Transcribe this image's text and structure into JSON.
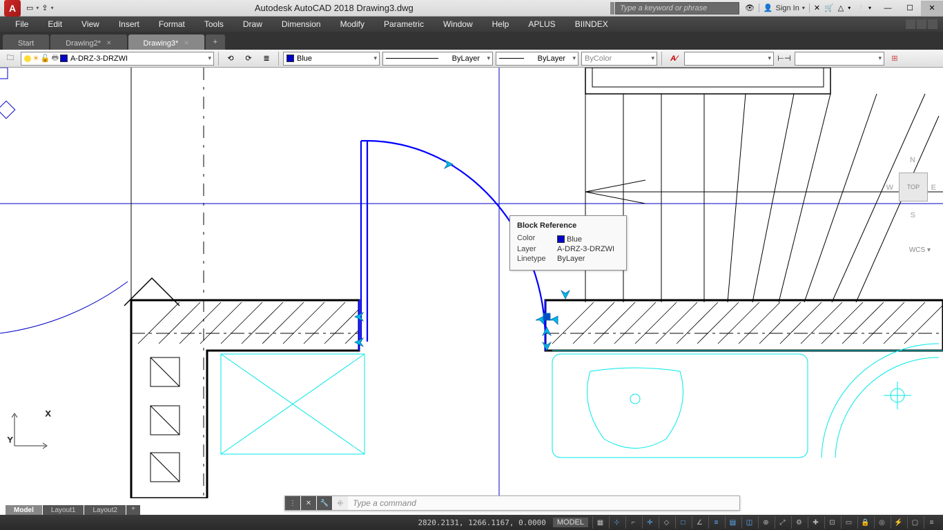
{
  "app": {
    "title": "Autodesk AutoCAD 2018   Drawing3.dwg",
    "search_placeholder": "Type a keyword or phrase",
    "signin": "Sign In"
  },
  "menus": [
    "File",
    "Edit",
    "View",
    "Insert",
    "Format",
    "Tools",
    "Draw",
    "Dimension",
    "Modify",
    "Parametric",
    "Window",
    "Help",
    "APLUS",
    "BIINDEX"
  ],
  "doc_tabs": [
    {
      "label": "Start",
      "active": false
    },
    {
      "label": "Drawing2*",
      "active": false
    },
    {
      "label": "Drawing3*",
      "active": true
    }
  ],
  "toolbar": {
    "layer": "A-DRZ-3-DRZWI",
    "color": "Blue",
    "linetype": "ByLayer",
    "lineweight": "ByLayer",
    "plotstyle": "ByColor"
  },
  "tooltip": {
    "title": "Block Reference",
    "rows": [
      {
        "label": "Color",
        "value": "Blue",
        "swatch": true
      },
      {
        "label": "Layer",
        "value": "A-DRZ-3-DRZWI"
      },
      {
        "label": "Linetype",
        "value": "ByLayer"
      }
    ]
  },
  "command_placeholder": "Type a command",
  "layout_tabs": [
    {
      "label": "Model",
      "active": true
    },
    {
      "label": "Layout1",
      "active": false
    },
    {
      "label": "Layout2",
      "active": false
    }
  ],
  "status": {
    "coords": "2820.2131, 1266.1167, 0.0000",
    "space": "MODEL"
  },
  "navcube": {
    "top": "TOP",
    "n": "N",
    "e": "E",
    "s": "S",
    "w": "W",
    "wcs": "WCS ▾"
  }
}
